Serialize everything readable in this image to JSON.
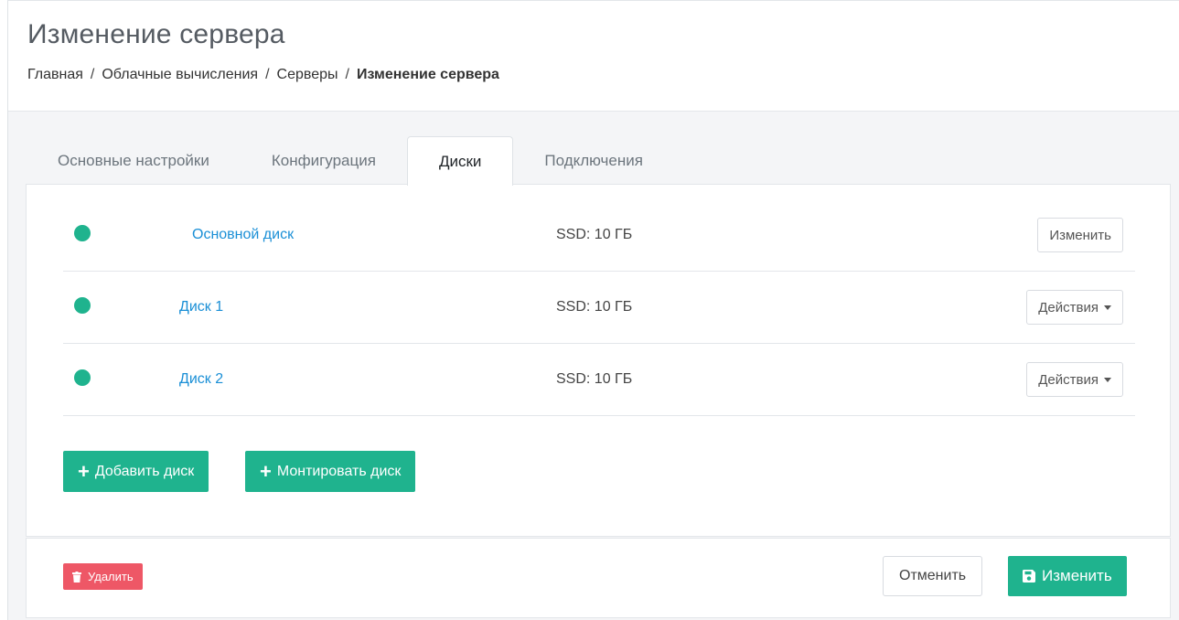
{
  "header": {
    "title": "Изменение сервера",
    "breadcrumb": [
      {
        "label": "Главная"
      },
      {
        "label": "Облачные вычисления"
      },
      {
        "label": "Серверы"
      },
      {
        "label": "Изменение сервера"
      }
    ],
    "separator": "/"
  },
  "tabs": [
    {
      "label": "Основные настройки",
      "active": false
    },
    {
      "label": "Конфигурация",
      "active": false
    },
    {
      "label": "Диски",
      "active": true
    },
    {
      "label": "Подключения",
      "active": false
    }
  ],
  "disks": [
    {
      "name": "Основной диск",
      "size": "SSD: 10 ГБ",
      "action": "Изменить",
      "status_color": "#1fb38e"
    },
    {
      "name": "Диск 1",
      "size": "SSD: 10 ГБ",
      "action": "Действия",
      "status_color": "#1fb38e"
    },
    {
      "name": "Диск 2",
      "size": "SSD: 10 ГБ",
      "action": "Действия",
      "status_color": "#1fb38e"
    }
  ],
  "actions": {
    "add_disk": "Добавить диск",
    "mount_disk": "Монтировать диск",
    "plus_icon": "plus-icon"
  },
  "footer": {
    "delete_label": "Удалить",
    "cancel_label": "Отменить",
    "save_label": "Изменить",
    "delete_icon": "trash-icon",
    "save_icon": "floppy-disk-icon"
  },
  "colors": {
    "accent": "#1fb38e",
    "danger": "#ee5766",
    "link": "#1a8fd6"
  }
}
